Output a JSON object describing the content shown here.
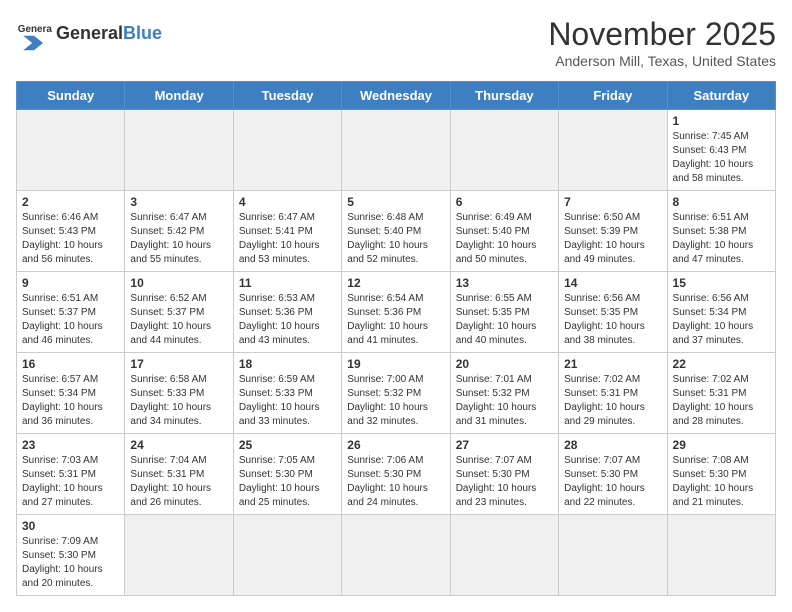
{
  "header": {
    "logo_general": "General",
    "logo_blue": "Blue",
    "month": "November 2025",
    "location": "Anderson Mill, Texas, United States"
  },
  "days_of_week": [
    "Sunday",
    "Monday",
    "Tuesday",
    "Wednesday",
    "Thursday",
    "Friday",
    "Saturday"
  ],
  "weeks": [
    [
      {
        "day": null,
        "data": null
      },
      {
        "day": null,
        "data": null
      },
      {
        "day": null,
        "data": null
      },
      {
        "day": null,
        "data": null
      },
      {
        "day": null,
        "data": null
      },
      {
        "day": null,
        "data": null
      },
      {
        "day": "1",
        "data": "Sunrise: 7:45 AM\nSunset: 6:43 PM\nDaylight: 10 hours\nand 58 minutes."
      }
    ],
    [
      {
        "day": "2",
        "data": "Sunrise: 6:46 AM\nSunset: 5:43 PM\nDaylight: 10 hours\nand 56 minutes."
      },
      {
        "day": "3",
        "data": "Sunrise: 6:47 AM\nSunset: 5:42 PM\nDaylight: 10 hours\nand 55 minutes."
      },
      {
        "day": "4",
        "data": "Sunrise: 6:47 AM\nSunset: 5:41 PM\nDaylight: 10 hours\nand 53 minutes."
      },
      {
        "day": "5",
        "data": "Sunrise: 6:48 AM\nSunset: 5:40 PM\nDaylight: 10 hours\nand 52 minutes."
      },
      {
        "day": "6",
        "data": "Sunrise: 6:49 AM\nSunset: 5:40 PM\nDaylight: 10 hours\nand 50 minutes."
      },
      {
        "day": "7",
        "data": "Sunrise: 6:50 AM\nSunset: 5:39 PM\nDaylight: 10 hours\nand 49 minutes."
      },
      {
        "day": "8",
        "data": "Sunrise: 6:51 AM\nSunset: 5:38 PM\nDaylight: 10 hours\nand 47 minutes."
      }
    ],
    [
      {
        "day": "9",
        "data": "Sunrise: 6:51 AM\nSunset: 5:37 PM\nDaylight: 10 hours\nand 46 minutes."
      },
      {
        "day": "10",
        "data": "Sunrise: 6:52 AM\nSunset: 5:37 PM\nDaylight: 10 hours\nand 44 minutes."
      },
      {
        "day": "11",
        "data": "Sunrise: 6:53 AM\nSunset: 5:36 PM\nDaylight: 10 hours\nand 43 minutes."
      },
      {
        "day": "12",
        "data": "Sunrise: 6:54 AM\nSunset: 5:36 PM\nDaylight: 10 hours\nand 41 minutes."
      },
      {
        "day": "13",
        "data": "Sunrise: 6:55 AM\nSunset: 5:35 PM\nDaylight: 10 hours\nand 40 minutes."
      },
      {
        "day": "14",
        "data": "Sunrise: 6:56 AM\nSunset: 5:35 PM\nDaylight: 10 hours\nand 38 minutes."
      },
      {
        "day": "15",
        "data": "Sunrise: 6:56 AM\nSunset: 5:34 PM\nDaylight: 10 hours\nand 37 minutes."
      }
    ],
    [
      {
        "day": "16",
        "data": "Sunrise: 6:57 AM\nSunset: 5:34 PM\nDaylight: 10 hours\nand 36 minutes."
      },
      {
        "day": "17",
        "data": "Sunrise: 6:58 AM\nSunset: 5:33 PM\nDaylight: 10 hours\nand 34 minutes."
      },
      {
        "day": "18",
        "data": "Sunrise: 6:59 AM\nSunset: 5:33 PM\nDaylight: 10 hours\nand 33 minutes."
      },
      {
        "day": "19",
        "data": "Sunrise: 7:00 AM\nSunset: 5:32 PM\nDaylight: 10 hours\nand 32 minutes."
      },
      {
        "day": "20",
        "data": "Sunrise: 7:01 AM\nSunset: 5:32 PM\nDaylight: 10 hours\nand 31 minutes."
      },
      {
        "day": "21",
        "data": "Sunrise: 7:02 AM\nSunset: 5:31 PM\nDaylight: 10 hours\nand 29 minutes."
      },
      {
        "day": "22",
        "data": "Sunrise: 7:02 AM\nSunset: 5:31 PM\nDaylight: 10 hours\nand 28 minutes."
      }
    ],
    [
      {
        "day": "23",
        "data": "Sunrise: 7:03 AM\nSunset: 5:31 PM\nDaylight: 10 hours\nand 27 minutes."
      },
      {
        "day": "24",
        "data": "Sunrise: 7:04 AM\nSunset: 5:31 PM\nDaylight: 10 hours\nand 26 minutes."
      },
      {
        "day": "25",
        "data": "Sunrise: 7:05 AM\nSunset: 5:30 PM\nDaylight: 10 hours\nand 25 minutes."
      },
      {
        "day": "26",
        "data": "Sunrise: 7:06 AM\nSunset: 5:30 PM\nDaylight: 10 hours\nand 24 minutes."
      },
      {
        "day": "27",
        "data": "Sunrise: 7:07 AM\nSunset: 5:30 PM\nDaylight: 10 hours\nand 23 minutes."
      },
      {
        "day": "28",
        "data": "Sunrise: 7:07 AM\nSunset: 5:30 PM\nDaylight: 10 hours\nand 22 minutes."
      },
      {
        "day": "29",
        "data": "Sunrise: 7:08 AM\nSunset: 5:30 PM\nDaylight: 10 hours\nand 21 minutes."
      }
    ],
    [
      {
        "day": "30",
        "data": "Sunrise: 7:09 AM\nSunset: 5:30 PM\nDaylight: 10 hours\nand 20 minutes."
      },
      {
        "day": null,
        "data": null
      },
      {
        "day": null,
        "data": null
      },
      {
        "day": null,
        "data": null
      },
      {
        "day": null,
        "data": null
      },
      {
        "day": null,
        "data": null
      },
      {
        "day": null,
        "data": null
      }
    ]
  ]
}
